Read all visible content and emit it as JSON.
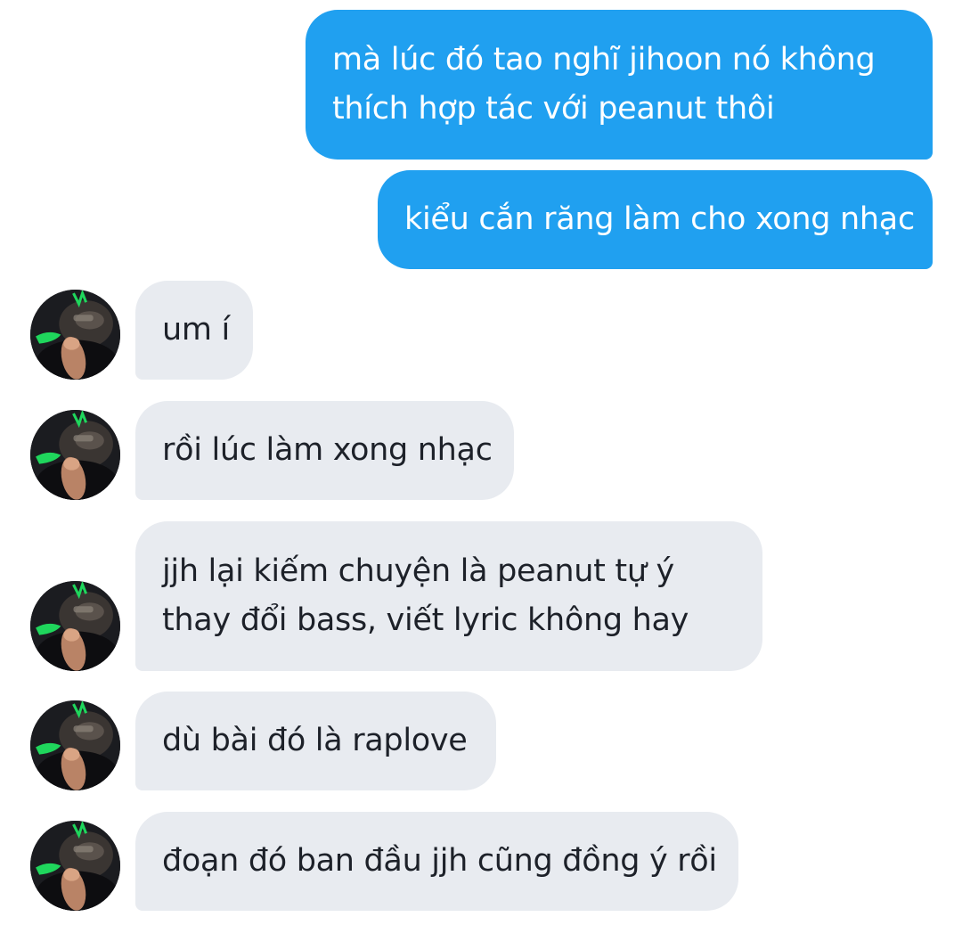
{
  "colors": {
    "outgoing_bubble": "#20a0f0",
    "incoming_bubble": "#e8ebf0",
    "incoming_text": "#1d2129",
    "outgoing_text": "#ffffff"
  },
  "avatar_icon": "user-avatar-photo",
  "messages": [
    {
      "direction": "outgoing",
      "lines": [
        "mà lúc đó tao nghĩ jihoon nó không",
        "thích hợp tác với peanut thôi"
      ]
    },
    {
      "direction": "outgoing",
      "lines": [
        "kiểu cắn răng làm cho xong nhạc"
      ]
    },
    {
      "direction": "incoming",
      "lines": [
        "um í"
      ]
    },
    {
      "direction": "incoming",
      "lines": [
        "rồi lúc làm xong nhạc"
      ]
    },
    {
      "direction": "incoming",
      "lines": [
        "jjh lại kiếm chuyện là peanut tự ý",
        "thay đổi bass, viết lyric không hay"
      ]
    },
    {
      "direction": "incoming",
      "lines": [
        "dù bài đó là raplove"
      ]
    },
    {
      "direction": "incoming",
      "lines": [
        "đoạn đó ban đầu jjh cũng đồng ý rồi"
      ]
    }
  ]
}
